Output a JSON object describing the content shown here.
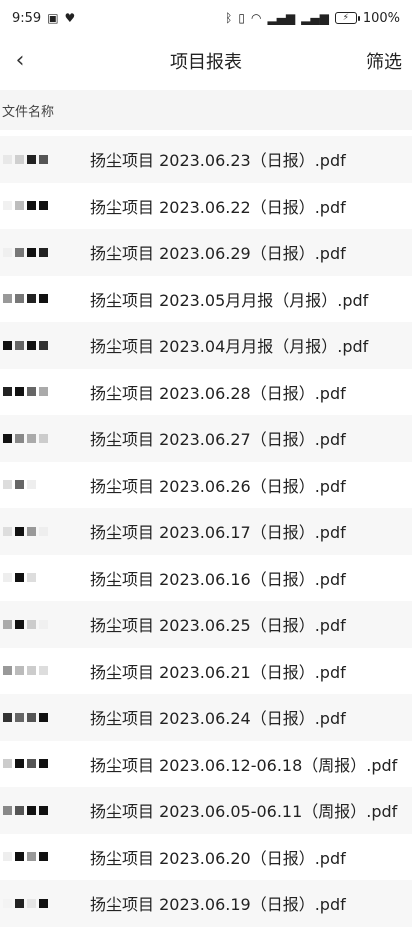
{
  "status": {
    "time": "9:59",
    "battery": "100%"
  },
  "header": {
    "back_icon": "chevron-left-icon",
    "title": "项目报表",
    "filter_label": "筛选"
  },
  "section": {
    "label": "文件名称"
  },
  "files": [
    "扬尘项目 2023.06.23（日报）.pdf",
    "扬尘项目 2023.06.22（日报）.pdf",
    "扬尘项目 2023.06.29（日报）.pdf",
    "扬尘项目 2023.05月月报（月报）.pdf",
    "扬尘项目 2023.04月月报（月报）.pdf",
    "扬尘项目 2023.06.28（日报）.pdf",
    "扬尘项目 2023.06.27（日报）.pdf",
    "扬尘项目 2023.06.26（日报）.pdf",
    "扬尘项目 2023.06.17（日报）.pdf",
    "扬尘项目 2023.06.16（日报）.pdf",
    "扬尘项目 2023.06.25（日报）.pdf",
    "扬尘项目 2023.06.21（日报）.pdf",
    "扬尘项目 2023.06.24（日报）.pdf",
    "扬尘项目 2023.06.12-06.18（周报）.pdf",
    "扬尘项目 2023.06.05-06.11（周报）.pdf",
    "扬尘项目 2023.06.20（日报）.pdf",
    "扬尘项目 2023.06.19（日报）.pdf"
  ]
}
